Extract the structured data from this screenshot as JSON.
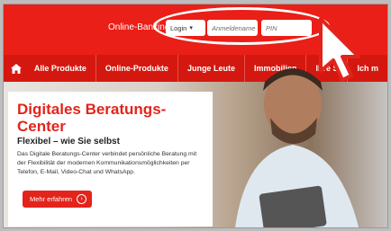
{
  "header": {
    "online_banking_label": "Online-Banking",
    "login_select": "Login",
    "username_placeholder": "Anmeldename",
    "pin_placeholder": "PIN"
  },
  "nav": {
    "items": [
      "Alle Produkte",
      "Online-Produkte",
      "Junge Leute",
      "Immobilien",
      "Ihre S",
      "Ich m"
    ]
  },
  "hero_card": {
    "title": "Digitales Beratungs-Center",
    "subtitle": "Flexibel – wie Sie selbst",
    "body": "Das Digitale Beratungs-Center verbindet persönliche Beratung mit der Flexibilität der modernen Kommunikationsmöglichkeiten per Telefon, E-Mail, Video-Chat und WhatsApp.",
    "cta_label": "Mehr erfahren"
  },
  "colors": {
    "brand_red": "#ea1f17",
    "nav_red": "#d5180f",
    "cta_red": "#e3241b"
  },
  "icons": {
    "home": "home-icon",
    "chevron": "chevron-down-icon",
    "cta_arrow": "chevron-right-circle-icon",
    "cursor": "mouse-pointer-icon"
  }
}
